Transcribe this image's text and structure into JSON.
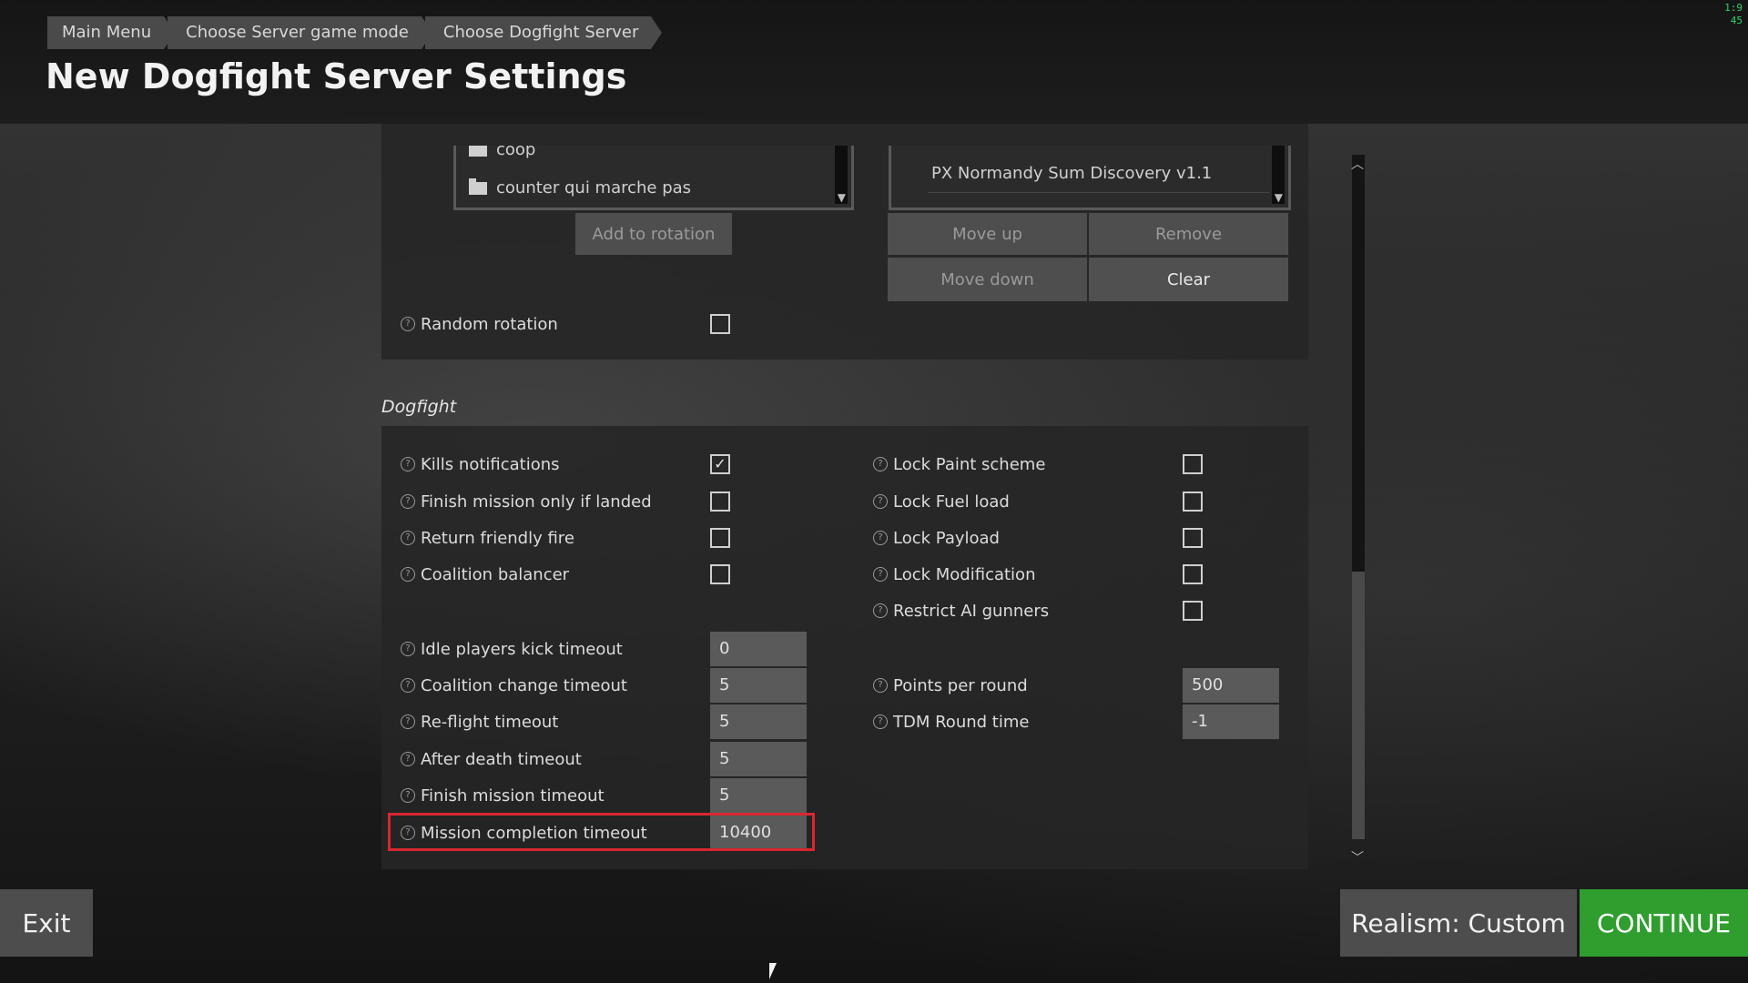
{
  "clock": [
    "1:9",
    "45"
  ],
  "breadcrumb": [
    "Main Menu",
    "Choose Server game mode",
    "Choose Dogfight Server"
  ],
  "page_title": "New Dogfight Server Settings",
  "missions_list": {
    "items": [
      "coop",
      "counter qui marche pas"
    ]
  },
  "rotation_list": {
    "items": [
      "PX Normandy Sum Discovery v1.1"
    ]
  },
  "buttons": {
    "add_to_rotation": "Add to rotation",
    "move_up": "Move up",
    "remove": "Remove",
    "move_down": "Move down",
    "clear": "Clear"
  },
  "random_rotation": {
    "label": "Random rotation",
    "checked": false
  },
  "section": "Dogfight",
  "left_checks": [
    {
      "label": "Kills notifications",
      "checked": true
    },
    {
      "label": "Finish mission only if landed",
      "checked": false
    },
    {
      "label": "Return friendly fire",
      "checked": false
    },
    {
      "label": "Coalition balancer",
      "checked": false
    }
  ],
  "right_checks": [
    {
      "label": "Lock Paint scheme",
      "checked": false
    },
    {
      "label": "Lock Fuel load",
      "checked": false
    },
    {
      "label": "Lock Payload",
      "checked": false
    },
    {
      "label": "Lock Modification",
      "checked": false
    },
    {
      "label": "Restrict AI gunners",
      "checked": false
    }
  ],
  "left_fields": [
    {
      "label": "Idle players kick timeout",
      "value": "0"
    },
    {
      "label": "Coalition change timeout",
      "value": "5"
    },
    {
      "label": "Re-flight timeout",
      "value": "5"
    },
    {
      "label": "After death timeout",
      "value": "5"
    },
    {
      "label": "Finish mission timeout",
      "value": "5"
    },
    {
      "label": "Mission completion timeout",
      "value": "10400"
    }
  ],
  "right_fields": [
    {
      "label": "Points per round",
      "value": "500"
    },
    {
      "label": "TDM Round time",
      "value": "-1"
    }
  ],
  "bottom": {
    "exit": "Exit",
    "realism": "Realism: Custom",
    "continue": "CONTINUE"
  },
  "check_glyph": "✓",
  "help_glyph": "?",
  "colors": {
    "continue": "#2f9e2f",
    "highlight": "#d9262f"
  }
}
